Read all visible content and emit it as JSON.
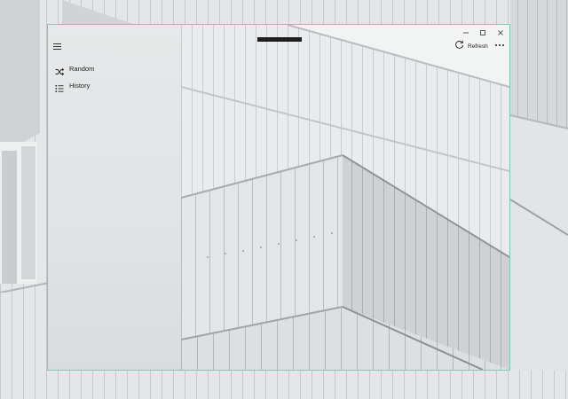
{
  "window": {
    "accent_border": "#7fc9b3"
  },
  "nav": {
    "menu_icon": "hamburger-icon",
    "items": [
      {
        "label": "Random",
        "icon": "shuffle-icon"
      },
      {
        "label": "History",
        "icon": "list-icon"
      }
    ]
  },
  "commandbar": {
    "refresh_label": "Refresh",
    "refresh_icon": "refresh-icon",
    "more_icon": "more-icon"
  },
  "caption_buttons": [
    "minimize-icon",
    "maximize-icon",
    "close-icon"
  ]
}
